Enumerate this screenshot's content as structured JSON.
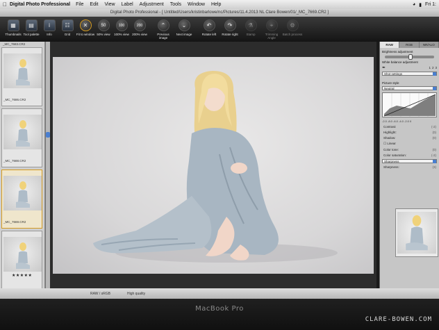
{
  "menubar": {
    "app_name": "Digital Photo Professional",
    "items": [
      "File",
      "Edit",
      "View",
      "Label",
      "Adjustment",
      "Tools",
      "Window",
      "Help"
    ],
    "clock": "Fri 1:"
  },
  "window": {
    "title": "Digital Photo Professional - [ Untitled/Users/kristinbarlowe/nc/Pictures/11.4.2013 NL Clare Bowen/01/_MC_7669.CR2 ]"
  },
  "toolbar": {
    "thumbnails": "Thumbnails",
    "tool_palette": "Tool palette",
    "info": "Info",
    "grid": "Grid",
    "fit_to_window": "Fit to window",
    "view_50": "50% view",
    "view_100": "100% view",
    "view_200": "200% view",
    "previous_image": "Previous image",
    "next_image": "Next image",
    "rotate_left": "Rotate left",
    "rotate_right": "Rotate right",
    "stamp": "Stamp",
    "trimming_angle": "Trimming Angle",
    "batch_process": "Batch process",
    "label_50": "50",
    "label_100": "100",
    "label_200": "200"
  },
  "filmstrip": {
    "thumbs": [
      {
        "caption": "_MC_7686.CR2",
        "stars": ""
      },
      {
        "caption": "_MC_7688.CR2",
        "stars": ""
      },
      {
        "caption": "_MC_7669.CR2",
        "stars": ""
      },
      {
        "caption": "",
        "stars": "★★★★★"
      }
    ],
    "top_caption": "_MC_7683.CR2"
  },
  "right_panel": {
    "tabs": [
      "RAW",
      "RGB",
      "NR/ALO"
    ],
    "brightness_label": "Brightness adjustment",
    "white_balance_label": "White balance adjustment",
    "white_balance_value": "Shot settings",
    "wb_buttons": [
      "1",
      "2",
      "3"
    ],
    "picture_style_label": "Picture style",
    "picture_style_value": "Neutral",
    "curve_scale": "-2.0  -8.0  -6.0  -4.0  -2.0   0",
    "params": [
      {
        "label": "Contrast:",
        "value": "(-2)"
      },
      {
        "label": "Highlight:",
        "value": "(0)"
      },
      {
        "label": "Shadow:",
        "value": "(0)"
      },
      {
        "label": "Linear",
        "value": ""
      },
      {
        "label": "Color tone:",
        "value": "(0)"
      },
      {
        "label": "Color saturation:",
        "value": "(-2)"
      }
    ],
    "sharpness_select": "Sharpness",
    "sharpness_label": "Sharpness:",
    "sharpness_value": "(3)"
  },
  "statusbar": {
    "file": "RAW / sRGB",
    "quality": "High quality"
  },
  "device": {
    "label": "MacBook Pro"
  },
  "watermark": "CLARE-BOWEN.COM",
  "colors": {
    "accent": "#4a7fd0",
    "selected_thumb": "#d49a20"
  }
}
